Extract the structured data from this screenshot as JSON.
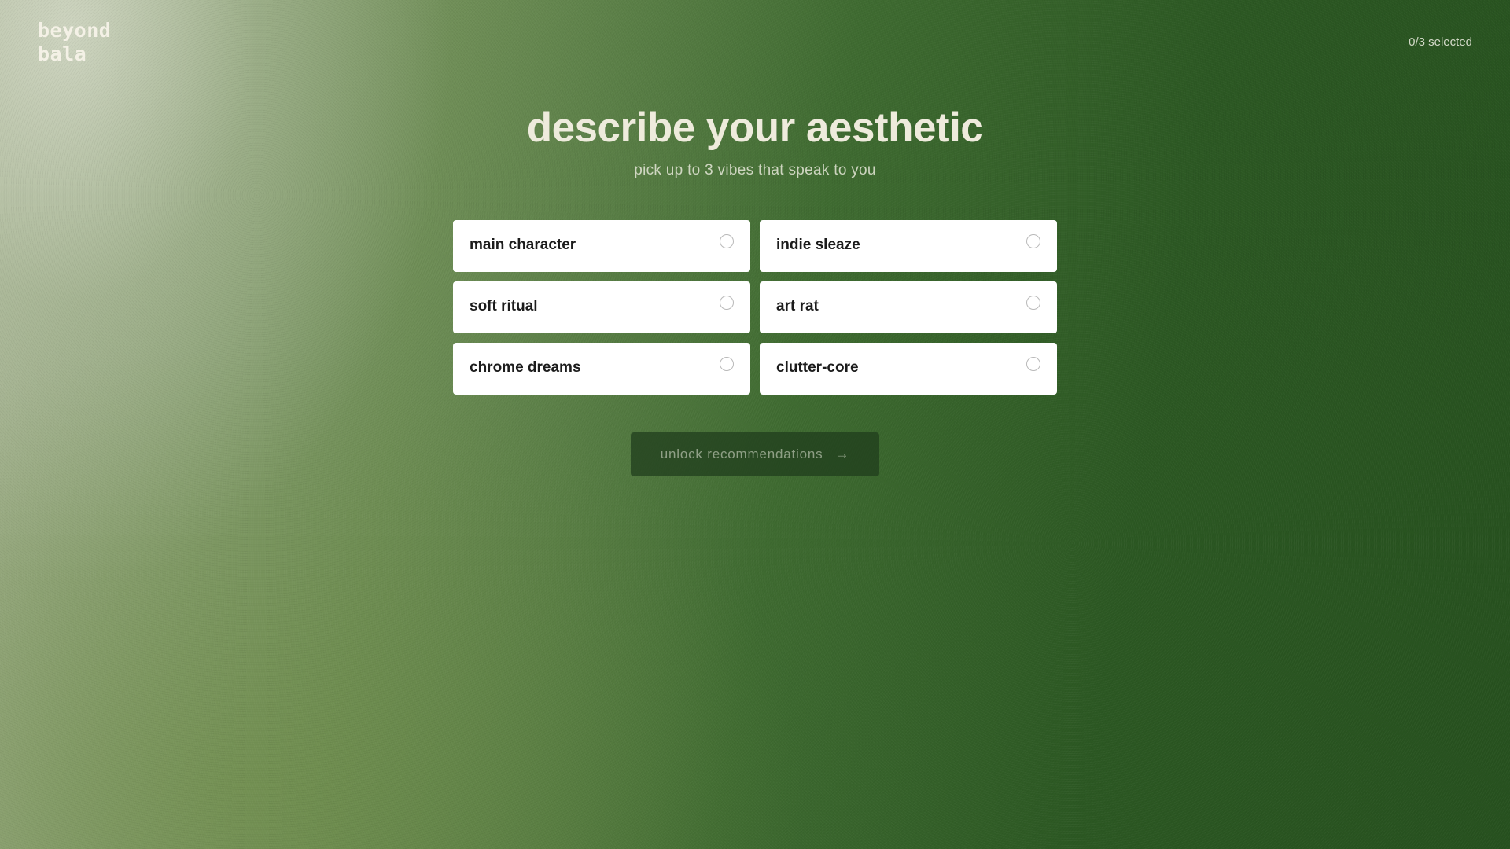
{
  "brand": {
    "line1": "beyond",
    "line2": "bala"
  },
  "selection": {
    "counter": "0/3 selected"
  },
  "header": {
    "title": "describe your aesthetic",
    "subtitle": "pick up to 3 vibes that speak to you"
  },
  "options": [
    {
      "label": "main character",
      "selected": false
    },
    {
      "label": "indie sleaze",
      "selected": false
    },
    {
      "label": "soft ritual",
      "selected": false
    },
    {
      "label": "art rat",
      "selected": false
    },
    {
      "label": "chrome dreams",
      "selected": false
    },
    {
      "label": "clutter-core",
      "selected": false
    }
  ],
  "cta": {
    "label": "unlock recommendations",
    "icon": "arrow-right-icon",
    "enabled": false
  },
  "colors": {
    "card_bg": "#ffffff",
    "title_text": "#eeebdc",
    "cta_bg": "#1e3c1c"
  }
}
